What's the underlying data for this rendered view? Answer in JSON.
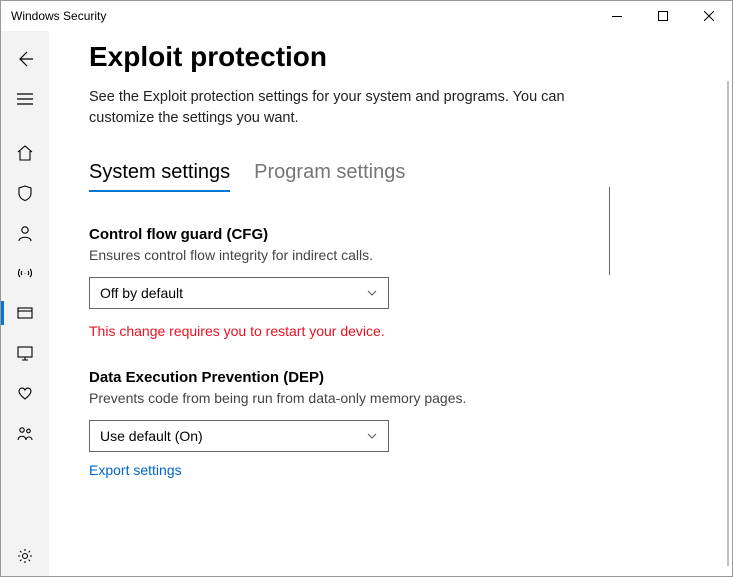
{
  "window": {
    "title": "Windows Security"
  },
  "page": {
    "title": "Exploit protection",
    "description": "See the Exploit protection settings for your system and programs.  You can customize the settings you want."
  },
  "tabs": {
    "system": "System settings",
    "program": "Program settings"
  },
  "settings": {
    "cfg": {
      "title": "Control flow guard (CFG)",
      "desc": "Ensures control flow integrity for indirect calls.",
      "value": "Off by default",
      "warning": "This change requires you to restart your device."
    },
    "dep": {
      "title": "Data Execution Prevention (DEP)",
      "desc": "Prevents code from being run from data-only memory pages.",
      "value": "Use default (On)"
    }
  },
  "links": {
    "export": "Export settings"
  }
}
